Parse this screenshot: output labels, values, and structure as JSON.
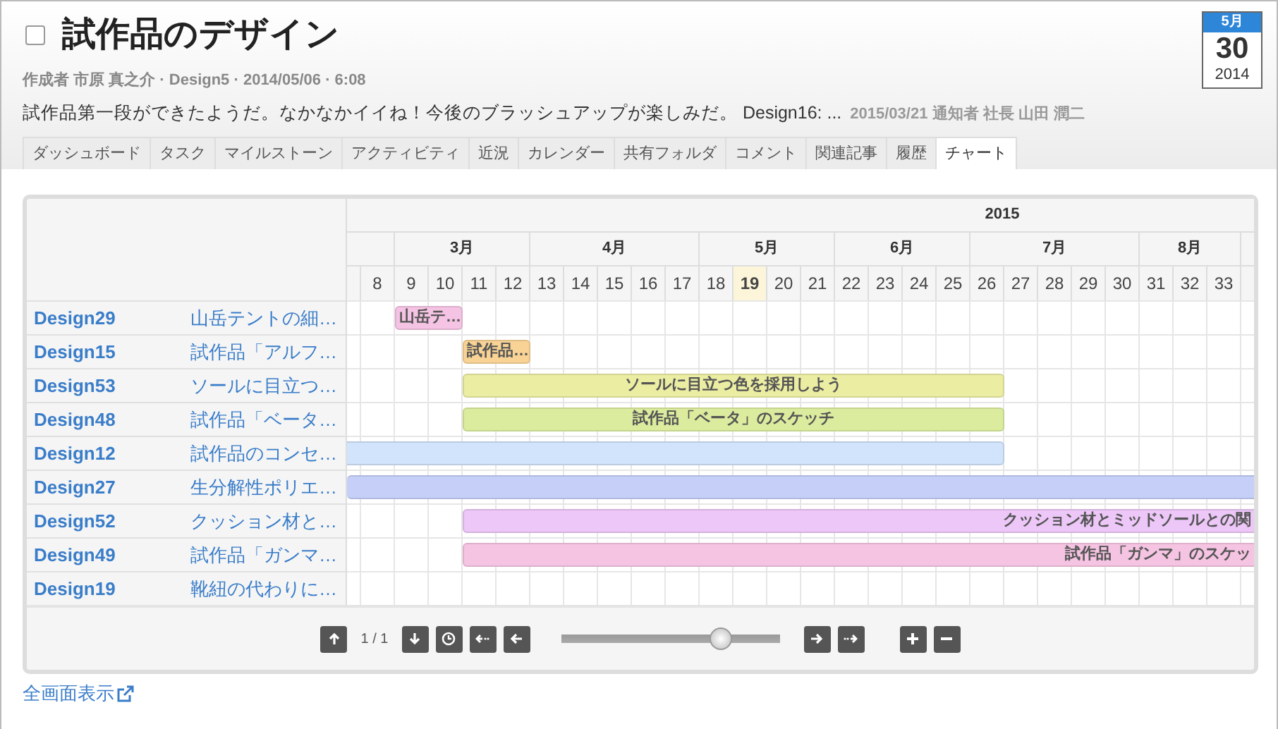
{
  "header": {
    "checked": false,
    "title": "試作品のデザイン",
    "meta": "作成者 市原 真之介 · Design5 · 2014/05/06 · 6:08",
    "comment": "試作品第一段ができたようだ。なかなかイイね！今後のブラッシュアップが楽しみだ。 Design16: ...",
    "comment_info": "2015/03/21 通知者 社長 山田 潤二"
  },
  "date_badge": {
    "month": "5月",
    "day": "30",
    "year": "2014"
  },
  "tabs": [
    {
      "label": "ダッシュボード",
      "selected": false
    },
    {
      "label": "タスク",
      "selected": false
    },
    {
      "label": "マイルストーン",
      "selected": false
    },
    {
      "label": "アクティビティ",
      "selected": false
    },
    {
      "label": "近況",
      "selected": false
    },
    {
      "label": "カレンダー",
      "selected": false
    },
    {
      "label": "共有フォルダ",
      "selected": false
    },
    {
      "label": "コメント",
      "selected": false
    },
    {
      "label": "関連記事",
      "selected": false
    },
    {
      "label": "履歴",
      "selected": false
    },
    {
      "label": "チャート",
      "selected": true
    }
  ],
  "gantt": {
    "year": "2015",
    "lead_days": [
      {
        "label": "8",
        "today": false
      }
    ],
    "months": [
      {
        "label": "3月",
        "days": [
          {
            "label": "9",
            "today": false
          },
          {
            "label": "10",
            "today": false
          },
          {
            "label": "11",
            "today": false
          },
          {
            "label": "12",
            "today": false
          }
        ]
      },
      {
        "label": "4月",
        "days": [
          {
            "label": "13",
            "today": false
          },
          {
            "label": "14",
            "today": false
          },
          {
            "label": "15",
            "today": false
          },
          {
            "label": "16",
            "today": false
          },
          {
            "label": "17",
            "today": false
          }
        ]
      },
      {
        "label": "5月",
        "days": [
          {
            "label": "18",
            "today": false
          },
          {
            "label": "19",
            "today": true
          },
          {
            "label": "20",
            "today": false
          },
          {
            "label": "21",
            "today": false
          }
        ]
      },
      {
        "label": "6月",
        "days": [
          {
            "label": "22",
            "today": false
          },
          {
            "label": "23",
            "today": false
          },
          {
            "label": "24",
            "today": false
          },
          {
            "label": "25",
            "today": false
          }
        ]
      },
      {
        "label": "7月",
        "days": [
          {
            "label": "26",
            "today": false
          },
          {
            "label": "27",
            "today": false
          },
          {
            "label": "28",
            "today": false
          },
          {
            "label": "29",
            "today": false
          },
          {
            "label": "30",
            "today": false
          }
        ]
      },
      {
        "label": "8月",
        "days": [
          {
            "label": "31",
            "today": false
          },
          {
            "label": "32",
            "today": false
          },
          {
            "label": "33",
            "today": false
          }
        ]
      }
    ],
    "rows": [
      {
        "key": "Design29",
        "title": "山岳テントの細…",
        "bar": {
          "label": "山岳テ…",
          "color": "#f5c3e3"
        }
      },
      {
        "key": "Design15",
        "title": "試作品「アルフ…",
        "bar": {
          "label": "試作品…",
          "color": "#f9d395"
        }
      },
      {
        "key": "Design53",
        "title": "ソールに目立つ…",
        "bar": {
          "label": "ソールに目立つ色を採用しよう",
          "color": "#ebeda3"
        }
      },
      {
        "key": "Design48",
        "title": "試作品「ベータ…",
        "bar": {
          "label": "試作品「ベータ」のスケッチ",
          "color": "#dcec9e"
        }
      },
      {
        "key": "Design12",
        "title": "試作品のコンセ…",
        "bar": {
          "color": "#d1e4fb"
        }
      },
      {
        "key": "Design27",
        "title": "生分解性ポリエ…",
        "bar": {
          "color": "#c5cff8"
        }
      },
      {
        "key": "Design52",
        "title": "クッション材と…",
        "bar": {
          "label": "クッション材とミッドソールとの関",
          "color": "#ecc7f8"
        }
      },
      {
        "key": "Design49",
        "title": "試作品「ガンマ…",
        "bar": {
          "label": "試作品「ガンマ」のスケッ",
          "color": "#f5c4e2"
        }
      },
      {
        "key": "Design19",
        "title": "靴紐の代わりに…"
      }
    ],
    "pager": "1 / 1",
    "zoom": {
      "level": 0.73
    }
  },
  "footer_link": "全画面表示"
}
